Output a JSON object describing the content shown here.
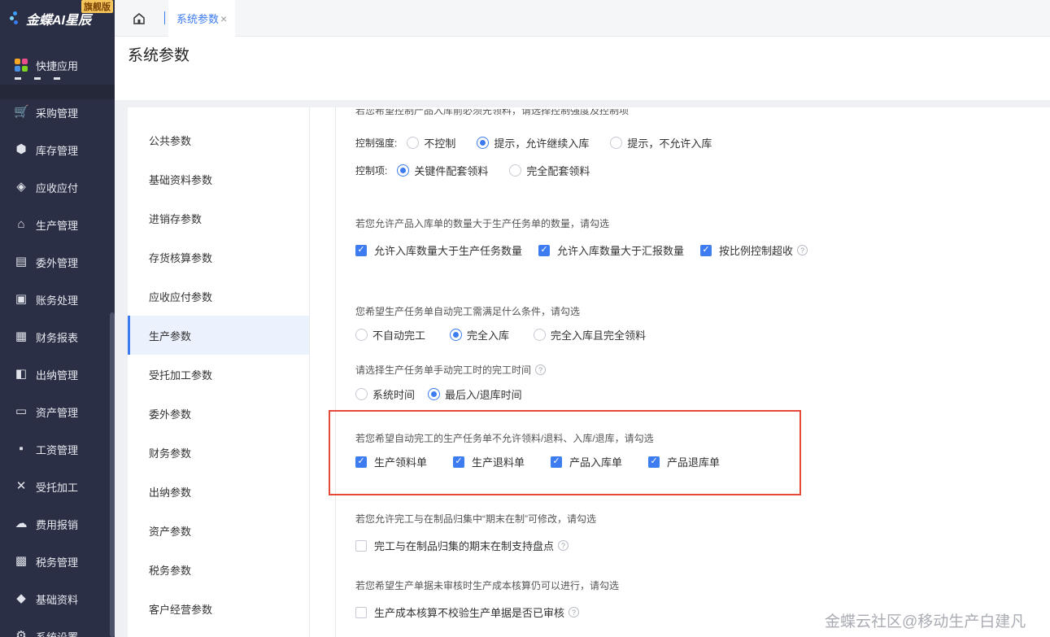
{
  "app": {
    "logo_text": "金蝶AI星辰",
    "logo_badge": "旗舰版"
  },
  "sidebar": {
    "quick": "快捷应用",
    "items": [
      {
        "label": "采购管理",
        "icon": "cart-icon",
        "glyph": "🛒"
      },
      {
        "label": "库存管理",
        "icon": "box-icon",
        "glyph": "⬢"
      },
      {
        "label": "应收应付",
        "icon": "receivable-icon",
        "glyph": "◈"
      },
      {
        "label": "生产管理",
        "icon": "factory-icon",
        "glyph": "⌂"
      },
      {
        "label": "委外管理",
        "icon": "outsource-icon",
        "glyph": "▤"
      },
      {
        "label": "账务处理",
        "icon": "ledger-icon",
        "glyph": "▣"
      },
      {
        "label": "财务报表",
        "icon": "report-icon",
        "glyph": "▦"
      },
      {
        "label": "出纳管理",
        "icon": "cashier-icon",
        "glyph": "◧"
      },
      {
        "label": "资产管理",
        "icon": "asset-icon",
        "glyph": "▭"
      },
      {
        "label": "工资管理",
        "icon": "salary-icon",
        "glyph": "▪"
      },
      {
        "label": "受托加工",
        "icon": "tools-icon",
        "glyph": "✕"
      },
      {
        "label": "费用报销",
        "icon": "expense-icon",
        "glyph": "☁"
      },
      {
        "label": "税务管理",
        "icon": "tax-icon",
        "glyph": "▩"
      },
      {
        "label": "基础资料",
        "icon": "layers-icon",
        "glyph": "◆"
      },
      {
        "label": "系统设置",
        "icon": "settings-icon",
        "glyph": "⚙"
      }
    ]
  },
  "tabs": {
    "active": "系统参数",
    "close": "×"
  },
  "page": {
    "title": "系统参数"
  },
  "menu": [
    "公共参数",
    "基础资料参数",
    "进销存参数",
    "存货核算参数",
    "应收应付参数",
    "生产参数",
    "受托加工参数",
    "委外参数",
    "财务参数",
    "出纳参数",
    "资产参数",
    "税务参数",
    "客户经营参数"
  ],
  "menu_active_index": 5,
  "settings": {
    "q0": "若您希望控制产品入库前必须先领料，请选择控制强度及控制项",
    "strength_label": "控制强度:",
    "strength_opts": [
      "不控制",
      "提示，允许继续入库",
      "提示，不允许入库"
    ],
    "item_label": "控制项:",
    "item_opts": [
      "关键件配套领料",
      "完全配套领料"
    ],
    "q1": "若您允许产品入库单的数量大于生产任务单的数量，请勾选",
    "q1_opts": [
      "允许入库数量大于生产任务数量",
      "允许入库数量大于汇报数量",
      "按比例控制超收"
    ],
    "q2": "您希望生产任务单自动完工需满足什么条件，请勾选",
    "q2_opts": [
      "不自动完工",
      "完全入库",
      "完全入库且完全领料"
    ],
    "q3": "请选择生产任务单手动完工时的完工时间",
    "q3_opts": [
      "系统时间",
      "最后入/退库时间"
    ],
    "q4": "若您希望自动完工的生产任务单不允许领料/退料、入库/退库，请勾选",
    "q4_opts": [
      "生产领料单",
      "生产退料单",
      "产品入库单",
      "产品退库单"
    ],
    "q5": "若您允许完工与在制品归集中“期末在制”可修改，请勾选",
    "q5_opt": "完工与在制品归集的期末在制支持盘点",
    "q6": "若您希望生产单据未审核时生产成本核算仍可以进行，请勾选",
    "q6_opt": "生产成本核算不校验生产单据是否已审核",
    "help": "?",
    "check": "✓"
  },
  "watermark": "金蝶云社区@移动生产白建凡",
  "colors": {
    "accent": "#3c7cf0",
    "sidebar": "#2a2f45",
    "highlight": "#e5493a"
  }
}
